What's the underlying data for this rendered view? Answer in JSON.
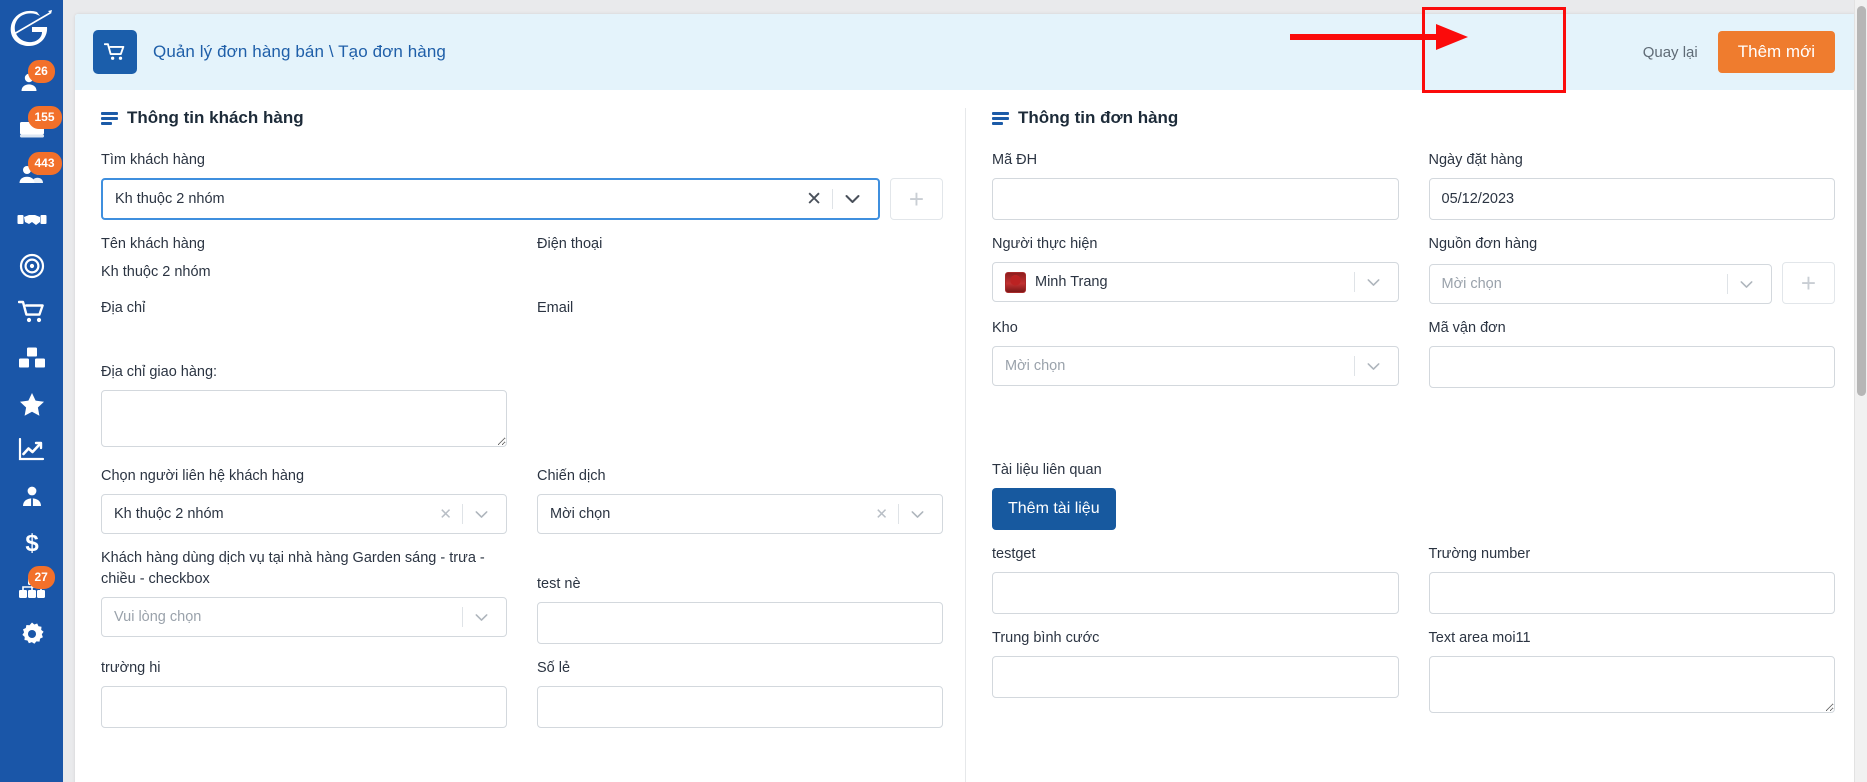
{
  "sidebar": {
    "logo_icon": "brand-logo-icon",
    "items": [
      {
        "icon": "user-badge-icon",
        "badge": "26"
      },
      {
        "icon": "contact-card-icon",
        "badge": "155"
      },
      {
        "icon": "users-group-icon",
        "badge": "443"
      },
      {
        "icon": "handshake-icon",
        "badge": ""
      },
      {
        "icon": "target-icon",
        "badge": ""
      },
      {
        "icon": "shopping-cart-icon",
        "badge": ""
      },
      {
        "icon": "boxes-icon",
        "badge": ""
      },
      {
        "icon": "star-icon",
        "badge": ""
      },
      {
        "icon": "chart-line-icon",
        "badge": ""
      },
      {
        "icon": "employee-icon",
        "badge": ""
      },
      {
        "icon": "dollar-icon",
        "badge": ""
      },
      {
        "icon": "org-chart-icon",
        "badge": "27"
      },
      {
        "icon": "gear-icon",
        "badge": ""
      }
    ]
  },
  "header": {
    "app_icon": "shopping-cart-icon",
    "breadcrumb": "Quản lý đơn hàng bán \\ Tạo đơn hàng",
    "back_label": "Quay lại",
    "primary_button": "Thêm mới",
    "accent_orange": "#ef7c2e",
    "accent_blue": "#1b5eab",
    "header_bg": "#e4f3fb",
    "annotation_color": "#fb0b0b"
  },
  "customer": {
    "section_title": "Thông tin khách hàng",
    "search": {
      "label": "Tìm khách hàng",
      "value": "Kh thuộc 2 nhóm",
      "clear_icon": "close-icon",
      "caret_icon": "chevron-down-icon",
      "add_icon": "plus-icon"
    },
    "name": {
      "label": "Tên khách hàng",
      "value": "Kh thuộc 2 nhóm"
    },
    "phone": {
      "label": "Điện thoại",
      "value": ""
    },
    "address": {
      "label": "Địa chỉ",
      "value": ""
    },
    "email": {
      "label": "Email",
      "value": ""
    },
    "shipping_address": {
      "label": "Địa chỉ giao hàng:",
      "value": ""
    },
    "contact": {
      "label": "Chọn người liên hệ khách hàng",
      "value": "Kh thuộc 2 nhóm",
      "clear_icon": "close-icon",
      "caret_icon": "chevron-down-icon"
    },
    "campaign": {
      "label": "Chiến dịch",
      "value": "Mời chọn",
      "clear_icon": "close-icon",
      "caret_icon": "chevron-down-icon"
    },
    "garden_service": {
      "label": "Khách hàng dùng dịch vụ tại nhà hàng Garden sáng - trưa - chiều - checkbox",
      "placeholder": "Vui lòng chọn",
      "caret_icon": "chevron-down-icon"
    },
    "test_ne": {
      "label": "test nè",
      "value": ""
    },
    "truong_hi": {
      "label": "trường hi",
      "value": ""
    },
    "so_le": {
      "label": "Số lẻ",
      "value": ""
    }
  },
  "order": {
    "section_title": "Thông tin đơn hàng",
    "code": {
      "label": "Mã ĐH",
      "value": ""
    },
    "order_date": {
      "label": "Ngày đặt hàng",
      "value": "05/12/2023"
    },
    "performer": {
      "label": "Người thực hiện",
      "value": "Minh Trang",
      "avatar_icon": "avatar",
      "caret_icon": "chevron-down-icon"
    },
    "source": {
      "label": "Nguồn đơn hàng",
      "placeholder": "Mời chọn",
      "caret_icon": "chevron-down-icon",
      "add_icon": "plus-icon"
    },
    "warehouse": {
      "label": "Kho",
      "placeholder": "Mời chọn",
      "caret_icon": "chevron-down-icon"
    },
    "tracking_code": {
      "label": "Mã vận đơn",
      "value": ""
    },
    "documents": {
      "label": "Tài liệu liên quan",
      "button_label": "Thêm tài liệu"
    },
    "testget": {
      "label": "testget",
      "value": ""
    },
    "number_field": {
      "label": "Trường number",
      "value": ""
    },
    "avg_fee": {
      "label": "Trung bình cước",
      "value": ""
    },
    "textarea_field": {
      "label": "Text area moi11",
      "value": ""
    }
  }
}
